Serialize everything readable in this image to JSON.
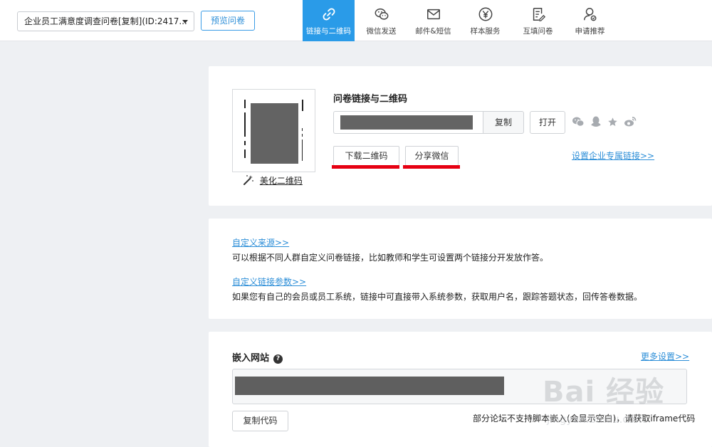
{
  "header": {
    "survey_select": {
      "value": "企业员工满意度调查问卷[复制](ID:2417..."
    },
    "preview_label": "预览问卷",
    "tabs": [
      {
        "label": "链接与二维码",
        "icon": "link-icon",
        "active": true
      },
      {
        "label": "微信发送",
        "icon": "wechat-icon",
        "active": false
      },
      {
        "label": "邮件&短信",
        "icon": "mail-icon",
        "active": false
      },
      {
        "label": "样本服务",
        "icon": "yen-icon",
        "active": false
      },
      {
        "label": "互填问卷",
        "icon": "survey-edit-icon",
        "active": false
      },
      {
        "label": "申请推荐",
        "icon": "user-recommend-icon",
        "active": false
      }
    ]
  },
  "link_card": {
    "title": "问卷链接与二维码",
    "copy_label": "复制",
    "open_label": "打开",
    "beautify_label": "美化二维码",
    "download_qr_label": "下载二维码",
    "share_wechat_label": "分享微信",
    "corp_link_label": "设置企业专属链接>>",
    "share_icons": [
      "wechat-icon",
      "qq-icon",
      "star-icon",
      "weibo-icon"
    ],
    "highlight_color": "#e60012"
  },
  "custom_card": {
    "source_link": "自定义来源>>",
    "source_desc": "可以根据不同人群自定义问卷链接，比如教师和学生可设置两个链接分开发放作答。",
    "param_link": "自定义链接参数>>",
    "param_desc": "如果您有自己的会员或员工系统，链接中可直接带入系统参数，获取用户名，跟踪答题状态，回传答卷数据。"
  },
  "embed_card": {
    "title": "嵌入网站",
    "more_link": "更多设置>>",
    "copy_code_label": "复制代码",
    "note": "部分论坛不支持脚本嵌入(会显示空白)，请获取iframe代码"
  },
  "watermark": {
    "text": "Bai 经验",
    "sub": "jingyan.baidu.com"
  },
  "colors": {
    "accent": "#2a9be8",
    "link": "#2e8fd8",
    "page_bg": "#eef0f3"
  }
}
